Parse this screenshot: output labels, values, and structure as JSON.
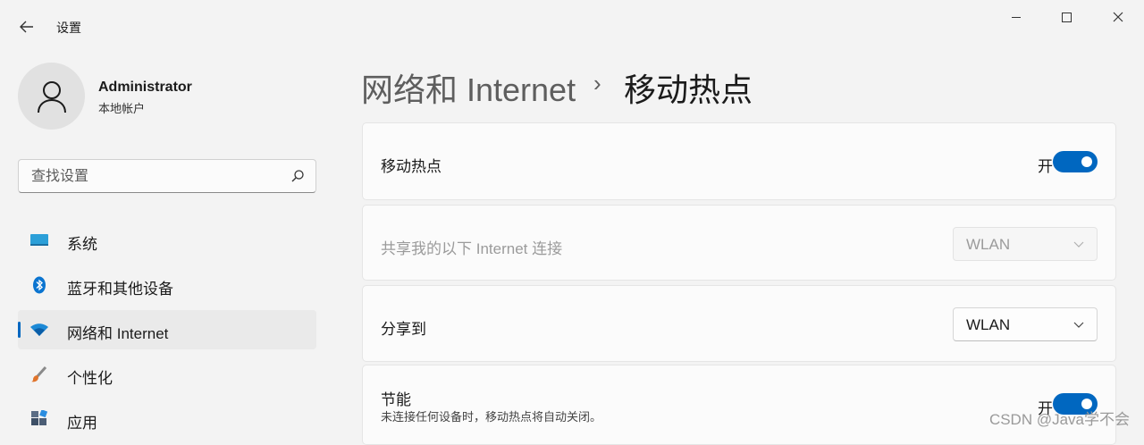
{
  "window": {
    "title": "设置"
  },
  "profile": {
    "name": "Administrator",
    "account_type": "本地帐户"
  },
  "search": {
    "placeholder": "查找设置",
    "value": ""
  },
  "sidebar": {
    "items": [
      {
        "label": "系统",
        "icon": "system-icon",
        "active": false
      },
      {
        "label": "蓝牙和其他设备",
        "icon": "bluetooth-icon",
        "active": false
      },
      {
        "label": "网络和 Internet",
        "icon": "wifi-icon",
        "active": true
      },
      {
        "label": "个性化",
        "icon": "brush-icon",
        "active": false
      },
      {
        "label": "应用",
        "icon": "apps-icon",
        "active": false
      }
    ]
  },
  "breadcrumb": {
    "parent": "网络和 Internet",
    "separator": "›",
    "current": "移动热点"
  },
  "settings": {
    "hotspot": {
      "label": "移动热点",
      "state": "开",
      "on": true
    },
    "share_from": {
      "label": "共享我的以下 Internet 连接",
      "value": "WLAN",
      "disabled": true
    },
    "share_to": {
      "label": "分享到",
      "value": "WLAN"
    },
    "power_saving": {
      "label": "节能",
      "description": "未连接任何设备时，移动热点将自动关闭。",
      "state": "开",
      "on": true
    }
  },
  "watermark": "CSDN @Java学不会",
  "colors": {
    "accent": "#0067c0",
    "background": "#f3f3f3",
    "card": "#fbfbfb"
  }
}
